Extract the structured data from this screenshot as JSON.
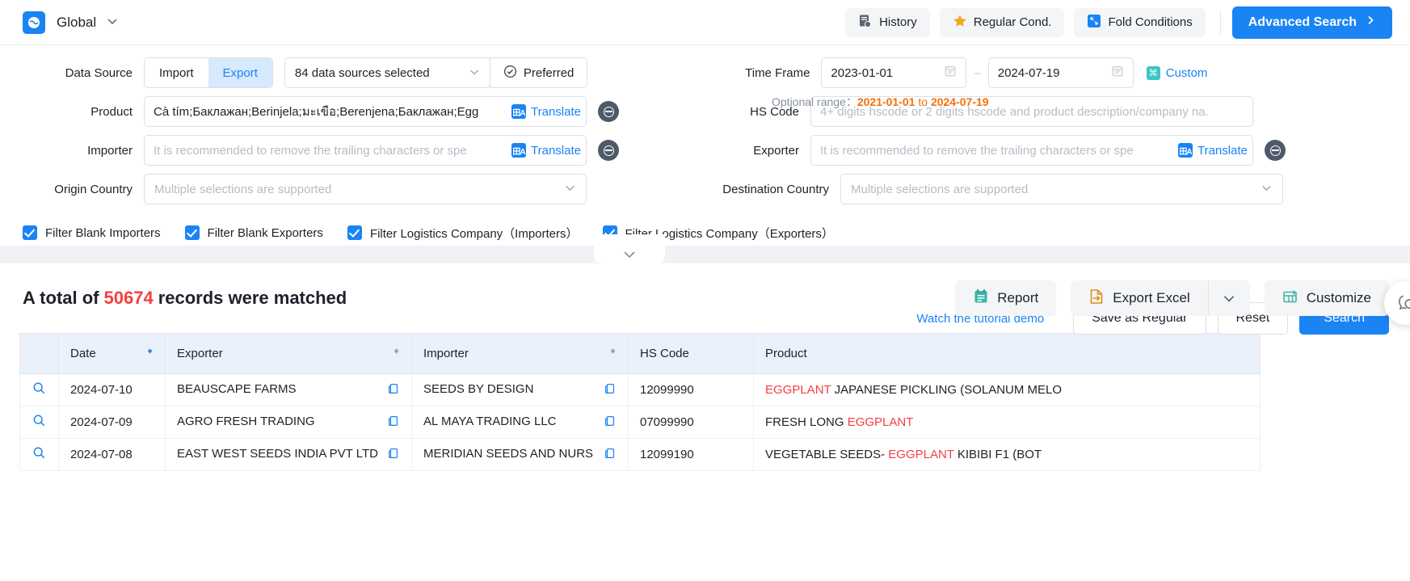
{
  "topbar": {
    "region_label": "Global",
    "buttons": [
      {
        "label": "History",
        "icon": "history-icon"
      },
      {
        "label": "Regular Cond.",
        "icon": "star-icon"
      },
      {
        "label": "Fold Conditions",
        "icon": "fold-icon"
      }
    ],
    "advanced_search_label": "Advanced Search",
    "advanced_search_arrow": "›"
  },
  "search": {
    "data_source": {
      "label": "Data Source",
      "segment": {
        "import": "Import",
        "export": "Export",
        "active": "Export"
      },
      "dropdown_value": "84 data sources selected",
      "preferred_label": "Preferred"
    },
    "time_frame": {
      "label": "Time Frame",
      "start": "2023-01-01",
      "end": "2024-07-19",
      "custom_label": "Custom",
      "optional_prefix": "Optional range：",
      "optional_from": "2021-01-01",
      "optional_to_word": "to",
      "optional_to": "2024-07-19"
    },
    "product": {
      "label": "Product",
      "value": "Cà tím;Баклажан;Berinjela;มะเขือ;Berenjena;Баклажан;Egg",
      "translate_label": "Translate"
    },
    "hs_code": {
      "label": "HS Code",
      "placeholder": "4+ digits hscode or 2 digits hscode and product description/company na."
    },
    "importer": {
      "label": "Importer",
      "placeholder": "It is recommended to remove the trailing characters or spe",
      "translate_label": "Translate"
    },
    "exporter": {
      "label": "Exporter",
      "placeholder": "It is recommended to remove the trailing characters or spe",
      "translate_label": "Translate"
    },
    "origin_country": {
      "label": "Origin Country",
      "placeholder": "Multiple selections are supported"
    },
    "destination_country": {
      "label": "Destination Country",
      "placeholder": "Multiple selections are supported"
    },
    "checkboxes": [
      {
        "label": "Filter Blank Importers",
        "checked": true
      },
      {
        "label": "Filter Blank Exporters",
        "checked": true
      },
      {
        "label": "Filter Logistics Company（Importers）",
        "checked": true
      },
      {
        "label": "Filter Logistics Company（Exporters）",
        "checked": true
      }
    ],
    "tutorial_link": "Watch the tutorial demo",
    "save_regular_label": "Save as Regular",
    "reset_label": "Reset",
    "search_label": "Search"
  },
  "results": {
    "total_prefix": "A total of",
    "total_count": "50674",
    "total_suffix": "records were matched",
    "report_label": "Report",
    "export_excel_label": "Export Excel",
    "customize_label": "Customize",
    "columns": [
      "Date",
      "Exporter",
      "Importer",
      "HS Code",
      "Product"
    ],
    "rows": [
      {
        "date": "2024-07-10",
        "exporter": "BEAUSCAPE FARMS",
        "importer": "SEEDS BY DESIGN",
        "hs_code": "12099990",
        "product_pre": "",
        "product_hl": "EGGPLANT",
        "product_post": " JAPANESE PICKLING (SOLANUM MELO"
      },
      {
        "date": "2024-07-09",
        "exporter": "AGRO FRESH TRADING",
        "importer": "AL MAYA TRADING LLC",
        "hs_code": "07099990",
        "product_pre": "FRESH LONG ",
        "product_hl": "EGGPLANT",
        "product_post": ""
      },
      {
        "date": "2024-07-08",
        "exporter": "EAST WEST SEEDS INDIA PVT LTD",
        "importer": "MERIDIAN SEEDS AND NURS",
        "hs_code": "12099190",
        "product_pre": "VEGETABLE SEEDS- ",
        "product_hl": "EGGPLANT",
        "product_post": " KIBIBI F1 (BOT"
      }
    ]
  },
  "colors": {
    "accent": "#1a84f5",
    "highlight": "#f53f3f",
    "orange": "#f5700a"
  }
}
